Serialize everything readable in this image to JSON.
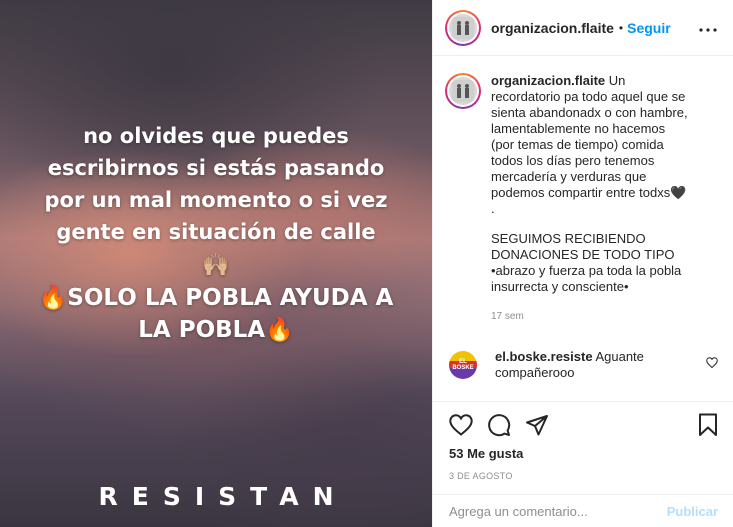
{
  "post": {
    "text_lines": [
      "no olvides que puedes",
      "escribirnos si estás pasando",
      "por un mal momento o si vez",
      "gente en situación de calle"
    ],
    "hands_emoji": "🙌🏼",
    "slogan_line1": "🔥SOLO LA POBLA AYUDA A",
    "slogan_line2": "LA POBLA🔥",
    "footer": "RESISTAN"
  },
  "header": {
    "username": "organizacion.flaite",
    "dot": "•",
    "follow_label": "Seguir",
    "more_icon": "more-horizontal-icon"
  },
  "caption": {
    "username": "organizacion.flaite",
    "text": "Un recordatorio pa todo aquel que se sienta abandonadx o con hambre, lamentablemente no hacemos (por temas de tiempo) comida todos los días pero tenemos mercadería y verduras que podemos compartir entre todxs🖤",
    "dot_line": ".",
    "line2": "SEGUIMOS RECIBIENDO DONACIONES DE TODO TIPO",
    "line3": "•abrazo y fuerza pa toda la pobla insurrecta y consciente•",
    "time": "17 sem"
  },
  "reply": {
    "username": "el.boske.resiste",
    "text": "Aguante compañerooo",
    "avatar_text": "EL BOSKE"
  },
  "actions": {
    "likes": "53 Me gusta",
    "date": "3 DE AGOSTO"
  },
  "comment_box": {
    "placeholder": "Agrega un comentario...",
    "publish_label": "Publicar"
  }
}
